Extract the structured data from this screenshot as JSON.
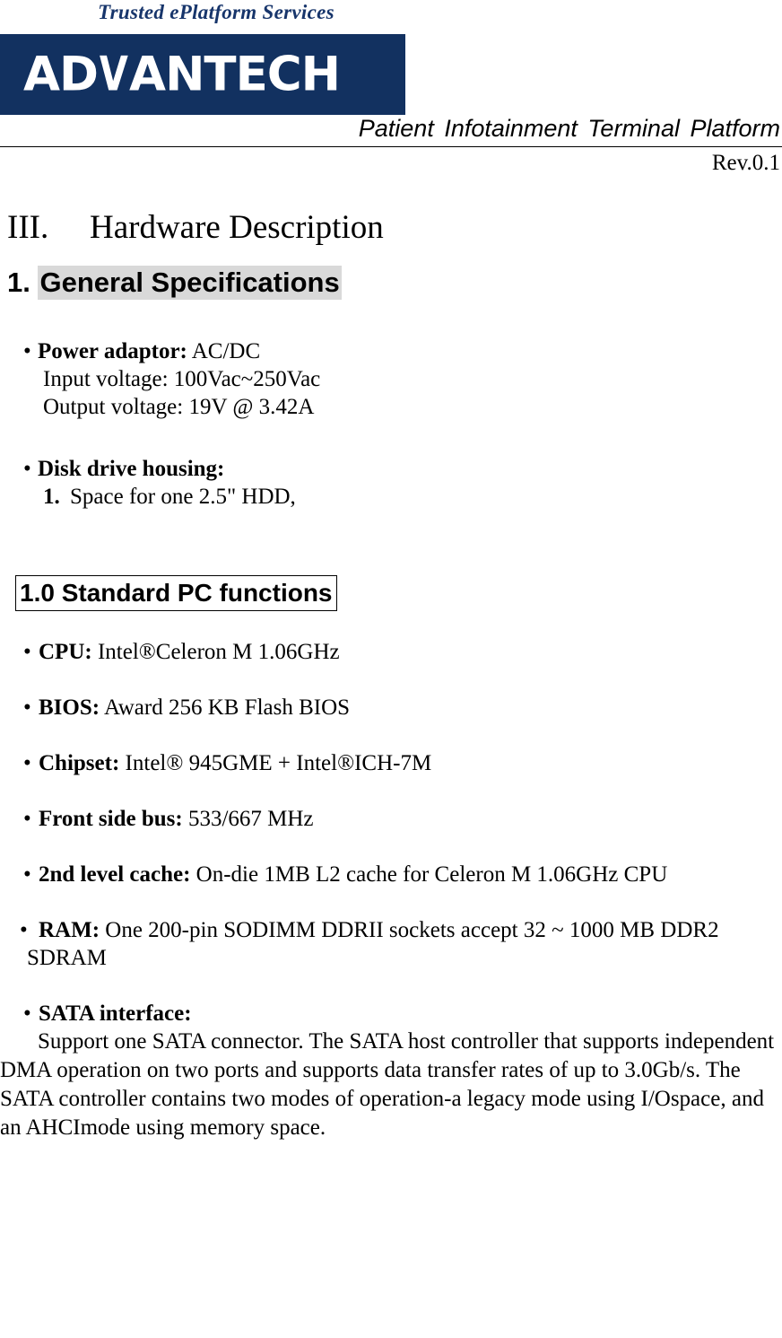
{
  "header": {
    "tagline": "Trusted ePlatform Services",
    "logo_text": "ADVANTECH",
    "logo_part_a": "AD",
    "logo_part_v": "V",
    "logo_part_b": "ANTECH",
    "logo_bg_color": "#123160",
    "tagline_color": "#17356b",
    "document_subtitle": "Patient Infotainment Terminal Platform",
    "revision": "Rev.0.1"
  },
  "section": {
    "numeral": "III.",
    "title": "Hardware Description",
    "subsection_number": "1.",
    "subsection_title": "General Specifications",
    "highlight_color": "#d9d9d9"
  },
  "general_specs": [
    {
      "bullet": "•",
      "label": "Power adaptor:",
      "value": " AC/DC",
      "sub_lines": [
        "Input voltage: 100Vac~250Vac",
        "Output voltage: 19V @ 3.42A"
      ]
    },
    {
      "bullet": "•",
      "label": "Disk drive housing:",
      "value": "",
      "numbered_items": [
        {
          "num": "1.",
          "text": "Space for one 2.5\" HDD,"
        }
      ]
    }
  ],
  "standard_pc": {
    "heading": "1.0 Standard PC functions",
    "items": [
      {
        "bullet": "•",
        "label": "CPU:",
        "value": " Intel®Celeron M 1.06GHz"
      },
      {
        "bullet": "•",
        "label": "BIOS:",
        "value": " Award 256 KB Flash BIOS"
      },
      {
        "bullet": "•",
        "label": "Chipset:",
        "value": " Intel® 945GME + Intel®ICH-7M"
      },
      {
        "bullet": "•",
        "label": "Front side bus:",
        "value": " 533/667 MHz"
      },
      {
        "bullet": "•",
        "label": "2nd level cache:",
        "value": " On-die 1MB L2 cache for Celeron M 1.06GHz CPU"
      },
      {
        "bullet": "•",
        "label": "RAM:",
        "value": " One 200-pin SODIMM DDRII sockets accept 32 ~ 1000 MB DDR2 SDRAM"
      }
    ],
    "sata": {
      "bullet": "•",
      "label": "SATA interface:",
      "paragraph": "Support one SATA connector. The SATA host controller that supports independent DMA operation on two ports and supports data transfer rates of up to 3.0Gb/s. The SATA controller contains two modes of operation-a legacy mode using I/Ospace, and an AHCImode using memory space."
    }
  }
}
